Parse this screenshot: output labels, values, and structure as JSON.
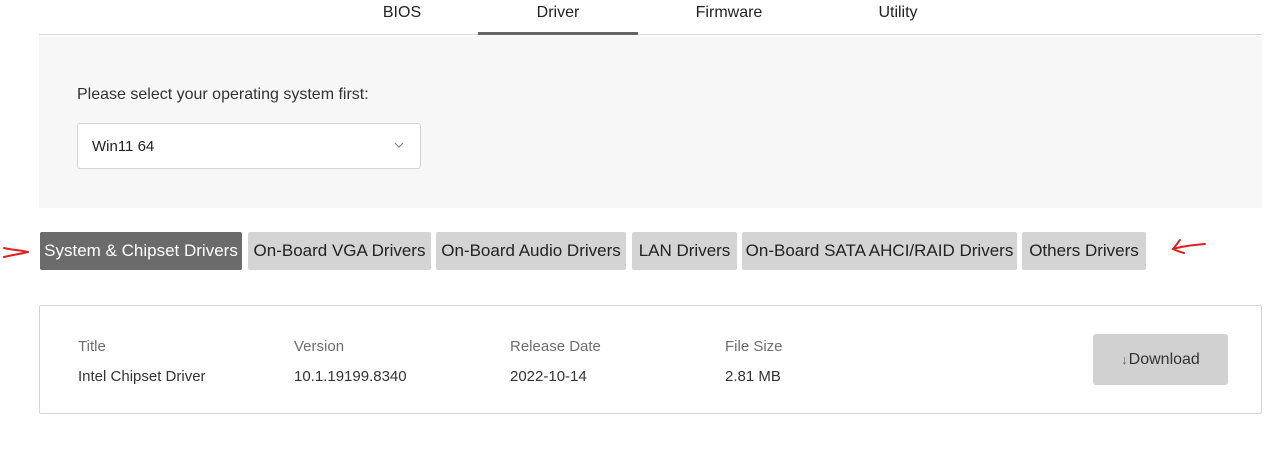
{
  "top_tabs": [
    {
      "label": "BIOS",
      "active": false
    },
    {
      "label": "Driver",
      "active": true
    },
    {
      "label": "Firmware",
      "active": false
    },
    {
      "label": "Utility",
      "active": false
    }
  ],
  "os_selector": {
    "label": "Please select your operating system first:",
    "selected": "Win11 64"
  },
  "categories": [
    {
      "label": "System & Chipset Drivers",
      "active": true
    },
    {
      "label": "On-Board VGA Drivers",
      "active": false
    },
    {
      "label": "On-Board Audio Drivers",
      "active": false
    },
    {
      "label": "LAN Drivers",
      "active": false
    },
    {
      "label": "On-Board SATA AHCI/RAID Drivers",
      "active": false
    },
    {
      "label": "Others Drivers",
      "active": false
    }
  ],
  "driver_table": {
    "headers": [
      "Title",
      "Version",
      "Release Date",
      "File Size"
    ],
    "row": [
      "Intel Chipset Driver",
      "10.1.19199.8340",
      "2022-10-14",
      "2.81 MB"
    ],
    "download_label": "Download",
    "download_icon": "arrow-down-icon"
  },
  "colors": {
    "active_category": "#6b6b6b",
    "inactive_category": "#d4d4d4",
    "annotation": "#e02020",
    "panel_bg": "#f7f7f7"
  }
}
